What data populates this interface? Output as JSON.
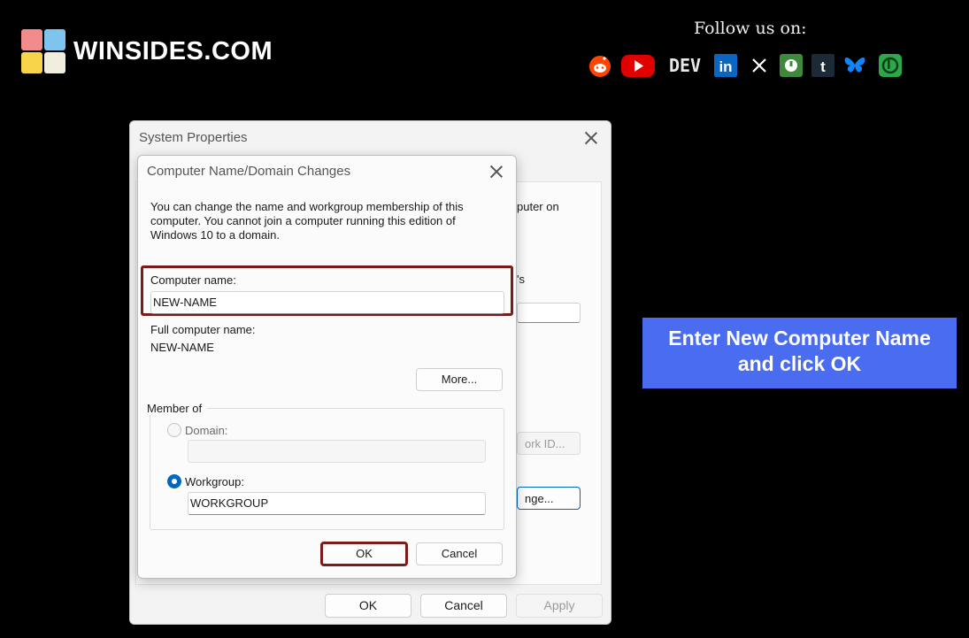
{
  "branding": {
    "site_name": "WINSIDES.COM",
    "follow_label": "Follow us on:",
    "socials": [
      {
        "icon": "reddit-icon",
        "glyph": "●",
        "color": "#ff4500"
      },
      {
        "icon": "youtube-icon",
        "glyph": "▶",
        "color": "#ff0000"
      },
      {
        "icon": "dev-icon",
        "glyph": "DEV",
        "color": "#f0f0f0"
      },
      {
        "icon": "linkedin-icon",
        "glyph": "in",
        "color": "#0a66c2"
      },
      {
        "icon": "x-icon",
        "glyph": "𝕏",
        "color": "#ffffff"
      },
      {
        "icon": "threads-icon",
        "glyph": "◉",
        "color": "#3a8f3a"
      },
      {
        "icon": "tumblr-icon",
        "glyph": "t",
        "color": "#35465c"
      },
      {
        "icon": "bluesky-icon",
        "glyph": "🦋",
        "color": "#1185fe"
      },
      {
        "icon": "bookmark-icon",
        "glyph": "b",
        "color": "#2aa84a"
      }
    ]
  },
  "callout": {
    "line1": "Enter New Computer Name",
    "line2": "and click OK"
  },
  "system_properties": {
    "title": "System Properties",
    "fragments": {
      "computer_on": "puter on",
      "apos_s": "'s",
      "network_id": "ork ID...",
      "change": "nge..."
    },
    "ok_label": "OK",
    "cancel_label": "Cancel",
    "apply_label": "Apply"
  },
  "dialog": {
    "title": "Computer Name/Domain Changes",
    "description": "You can change the name and workgroup membership of this computer. You cannot join a computer running this edition of Windows 10 to a domain.",
    "computer_name_label": "Computer name:",
    "computer_name_value": "NEW-NAME",
    "full_name_label": "Full computer name:",
    "full_name_value": "NEW-NAME",
    "more_label": "More...",
    "member_of_label": "Member of",
    "domain_label": "Domain:",
    "domain_value": "",
    "workgroup_label": "Workgroup:",
    "workgroup_value": "WORKGROUP",
    "ok_label": "OK",
    "cancel_label": "Cancel"
  }
}
